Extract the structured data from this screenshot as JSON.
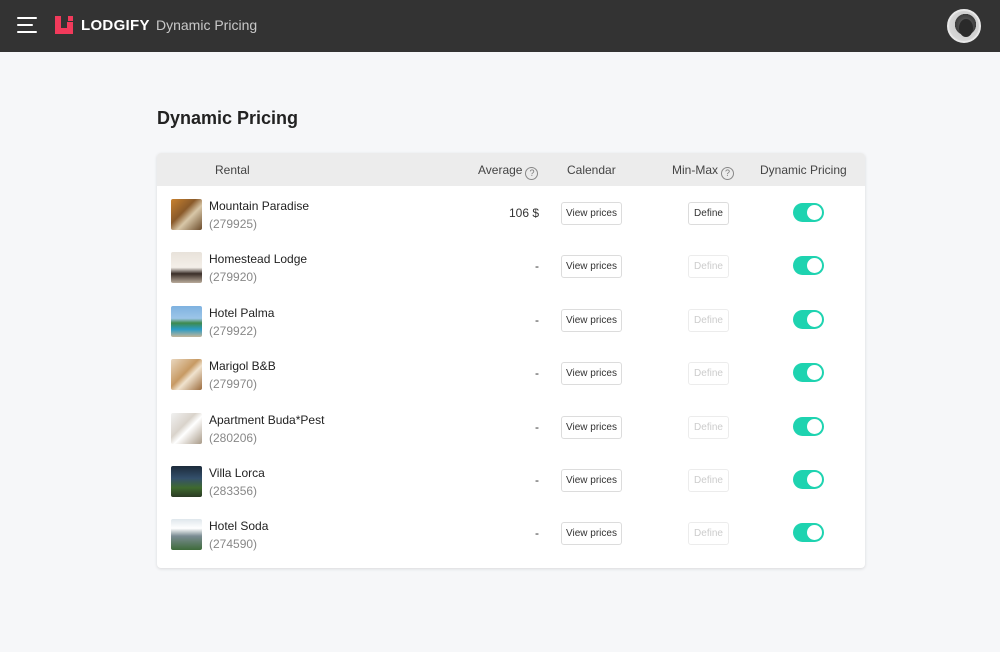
{
  "app": {
    "brand": "LODGIFY",
    "section": "Dynamic Pricing",
    "accent": "#1ed3b0",
    "brand_color": "#f23a5b"
  },
  "page": {
    "title": "Dynamic Pricing"
  },
  "table": {
    "headers": {
      "rental": "Rental",
      "average": "Average",
      "calendar": "Calendar",
      "minmax": "Min-Max",
      "dynamic": "Dynamic Pricing"
    },
    "help_icon": "?",
    "rows": [
      {
        "name": "Mountain Paradise",
        "id": "(279925)",
        "average": "106 $",
        "view": "View prices",
        "define": "Define",
        "define_enabled": true,
        "dynamic_on": true
      },
      {
        "name": "Homestead Lodge",
        "id": "(279920)",
        "average": "-",
        "view": "View prices",
        "define": "Define",
        "define_enabled": false,
        "dynamic_on": true
      },
      {
        "name": "Hotel Palma",
        "id": "(279922)",
        "average": "-",
        "view": "View prices",
        "define": "Define",
        "define_enabled": false,
        "dynamic_on": true
      },
      {
        "name": "Marigol B&B",
        "id": "(279970)",
        "average": "-",
        "view": "View prices",
        "define": "Define",
        "define_enabled": false,
        "dynamic_on": true
      },
      {
        "name": "Apartment Buda*Pest",
        "id": "(280206)",
        "average": "-",
        "view": "View prices",
        "define": "Define",
        "define_enabled": false,
        "dynamic_on": true
      },
      {
        "name": "Villa Lorca",
        "id": "(283356)",
        "average": "-",
        "view": "View prices",
        "define": "Define",
        "define_enabled": false,
        "dynamic_on": true
      },
      {
        "name": "Hotel Soda",
        "id": "(274590)",
        "average": "-",
        "view": "View prices",
        "define": "Define",
        "define_enabled": false,
        "dynamic_on": true
      }
    ]
  }
}
